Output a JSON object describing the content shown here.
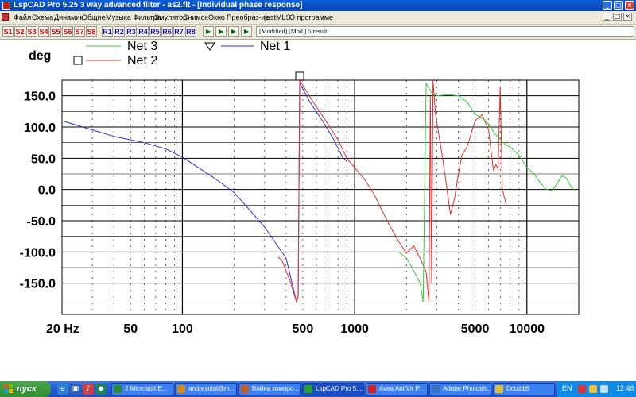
{
  "window": {
    "title": "LspCAD Pro 5.25 3 way advanced filter - as2.flt - [Individual phase response]",
    "controls": [
      "_",
      "□",
      "×"
    ]
  },
  "menu": {
    "items": [
      "Файл",
      "Схема",
      "Динамик",
      "Общие",
      "Музыка Фильтра",
      "Эмулятор",
      "Снимок",
      "Окно",
      "Преобраз-ие",
      "justMLS",
      "О программе"
    ],
    "mdi_controls": [
      "_",
      "□",
      "×"
    ]
  },
  "toolbar": {
    "s_buttons": [
      "S1",
      "S2",
      "S3",
      "S4",
      "S5",
      "S6",
      "S7",
      "S8"
    ],
    "r_buttons": [
      "R1",
      "R2",
      "R3",
      "R4",
      "R5",
      "R6",
      "R7",
      "R8"
    ],
    "icon_buttons": [
      "play-icon",
      "play-icon",
      "play-icon",
      "play-icon"
    ],
    "status": "[Modified] [Mod.] 5 result"
  },
  "chart_data": {
    "type": "line",
    "title": "",
    "ylabel": "deg",
    "xlabel": "",
    "x_scale": "log",
    "xlim": [
      20,
      20000
    ],
    "ylim": [
      -200,
      175
    ],
    "y_ticks": [
      {
        "value": 150,
        "label": "150.0"
      },
      {
        "value": 100,
        "label": "100.0"
      },
      {
        "value": 50,
        "label": "50.0"
      },
      {
        "value": 0,
        "label": "0.0"
      },
      {
        "value": -50,
        "label": "-50.0"
      },
      {
        "value": -100,
        "label": "-100.0"
      },
      {
        "value": -150,
        "label": "-150.0"
      }
    ],
    "x_ticks": [
      {
        "value": 20,
        "label": "20 Hz"
      },
      {
        "value": 50,
        "label": "50"
      },
      {
        "value": 100,
        "label": "100"
      },
      {
        "value": 500,
        "label": "500"
      },
      {
        "value": 1000,
        "label": "1000"
      },
      {
        "value": 5000,
        "label": "5000"
      },
      {
        "value": 10000,
        "label": "10000"
      }
    ],
    "grid": true,
    "legend": [
      {
        "name": "Net 3",
        "color": "#33cc33",
        "marker": ""
      },
      {
        "name": "Net 2",
        "color": "#e03030",
        "marker": "square"
      },
      {
        "name": "Net 1",
        "color": "#3333cc",
        "marker": "triangle"
      }
    ],
    "series": [
      {
        "name": "Net 1",
        "color": "#3333cc",
        "points": [
          [
            20,
            110
          ],
          [
            40,
            85
          ],
          [
            60,
            75
          ],
          [
            80,
            65
          ],
          [
            100,
            52
          ],
          [
            150,
            20
          ],
          [
            200,
            -5
          ],
          [
            300,
            -60
          ],
          [
            400,
            -110
          ],
          [
            460,
            -180
          ],
          [
            470,
            -170
          ],
          [
            480,
            170
          ],
          [
            550,
            140
          ],
          [
            650,
            110
          ],
          [
            750,
            82
          ],
          [
            850,
            52
          ],
          [
            900,
            45
          ]
        ]
      },
      {
        "name": "Net 2",
        "color": "#e03030",
        "points": [
          [
            360,
            -108
          ],
          [
            380,
            -115
          ],
          [
            420,
            -145
          ],
          [
            460,
            -180
          ],
          [
            470,
            -170
          ],
          [
            480,
            175
          ],
          [
            550,
            148
          ],
          [
            650,
            118
          ],
          [
            800,
            80
          ],
          [
            900,
            50
          ],
          [
            1000,
            35
          ],
          [
            1150,
            15
          ],
          [
            1300,
            -8
          ],
          [
            1450,
            -35
          ],
          [
            1600,
            -58
          ],
          [
            1800,
            -83
          ],
          [
            2000,
            -102
          ],
          [
            2200,
            -90
          ],
          [
            2400,
            -110
          ],
          [
            2600,
            -132
          ],
          [
            2700,
            -180
          ],
          [
            2750,
            150
          ],
          [
            2800,
            -150
          ],
          [
            2850,
            175
          ],
          [
            2950,
            120
          ],
          [
            3200,
            60
          ],
          [
            3400,
            10
          ],
          [
            3600,
            -40
          ],
          [
            3800,
            -15
          ],
          [
            4000,
            25
          ],
          [
            4200,
            55
          ],
          [
            4500,
            68
          ],
          [
            5000,
            110
          ],
          [
            5500,
            120
          ],
          [
            6000,
            95
          ],
          [
            6200,
            60
          ],
          [
            6400,
            30
          ],
          [
            6600,
            40
          ],
          [
            6800,
            33
          ],
          [
            7000,
            165
          ],
          [
            7200,
            0
          ],
          [
            7600,
            -25
          ]
        ]
      },
      {
        "name": "Net 3",
        "color": "#33cc33",
        "points": [
          [
            1800,
            -100
          ],
          [
            2000,
            -110
          ],
          [
            2200,
            -130
          ],
          [
            2400,
            -150
          ],
          [
            2500,
            -180
          ],
          [
            2600,
            170
          ],
          [
            2800,
            155
          ],
          [
            3000,
            150
          ],
          [
            3500,
            152
          ],
          [
            4000,
            150
          ],
          [
            4500,
            140
          ],
          [
            5000,
            120
          ],
          [
            5500,
            115
          ],
          [
            6000,
            105
          ],
          [
            6500,
            90
          ],
          [
            7000,
            80
          ],
          [
            7500,
            72
          ],
          [
            8000,
            68
          ],
          [
            9000,
            55
          ],
          [
            10000,
            35
          ],
          [
            11000,
            25
          ],
          [
            12000,
            10
          ],
          [
            13000,
            0
          ],
          [
            14000,
            -2
          ],
          [
            15000,
            10
          ],
          [
            16000,
            22
          ],
          [
            17000,
            18
          ],
          [
            18000,
            5
          ],
          [
            19000,
            -2
          ]
        ]
      }
    ]
  },
  "taskbar": {
    "start_label": "пуск",
    "tasks": [
      {
        "label": "2 Microsoft E...",
        "icon_color": "#2d8a2d"
      },
      {
        "label": "andreydial@m...",
        "icon_color": "#d08a20"
      },
      {
        "label": "Война компро...",
        "icon_color": "#c06020"
      },
      {
        "label": "LspCAD Pro 5....",
        "icon_color": "#2aa02a"
      },
      {
        "label": "Avira AntiVir P...",
        "icon_color": "#d42020"
      },
      {
        "label": "Adobe Photosh...",
        "icon_color": "#3a70c0"
      },
      {
        "label": "Dctxbb5",
        "icon_color": "#e0c040"
      }
    ],
    "active_task": 3,
    "tray_lang": "EN",
    "clock": "12:46"
  }
}
